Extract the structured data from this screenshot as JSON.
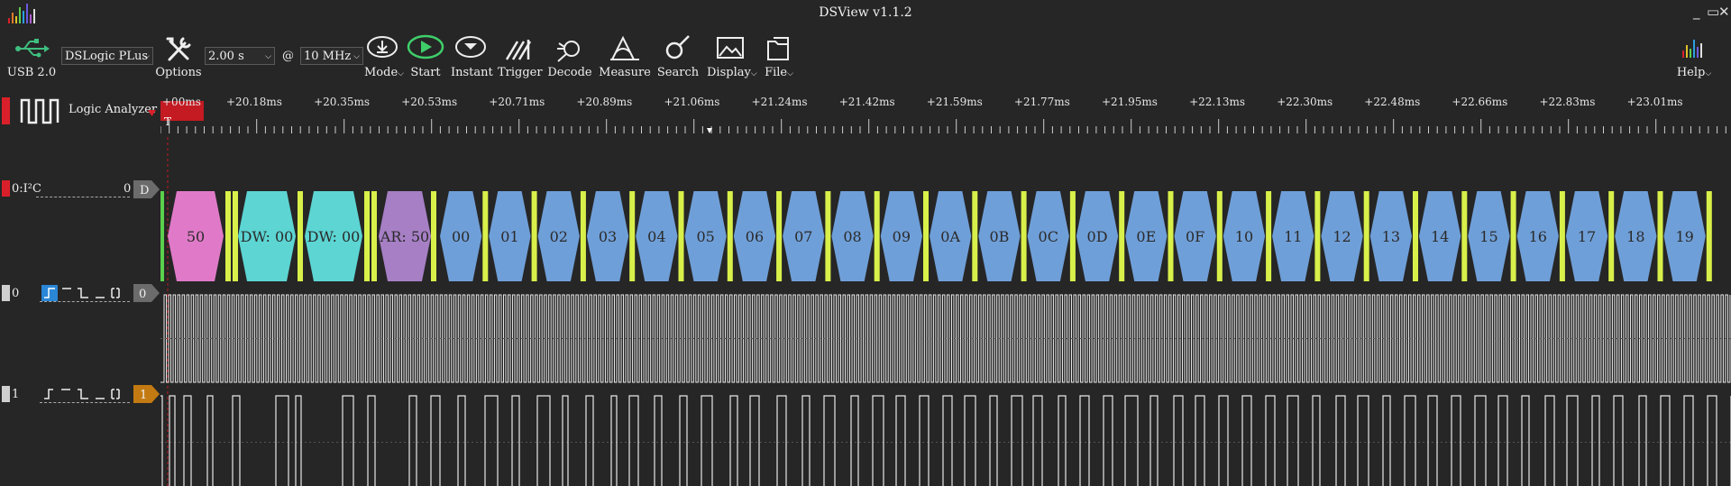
{
  "app": {
    "title": "DSView v1.1.2"
  },
  "toolbar": {
    "usb_label": "USB 2.0",
    "device": "DSLogic PLus",
    "options_label": "Options",
    "duration": "2.00 s",
    "at_symbol": "@",
    "samplerate": "10 MHz",
    "mode_label": "Mode",
    "start_label": "Start",
    "instant_label": "Instant",
    "trigger_label": "Trigger",
    "decode_label": "Decode",
    "measure_label": "Measure",
    "search_label": "Search",
    "display_label": "Display",
    "file_label": "File",
    "help_label": "Help"
  },
  "ruler": {
    "first_label": "+00ms",
    "trigger_marker": "T",
    "ticks": [
      "+20.18ms",
      "+20.35ms",
      "+20.53ms",
      "+20.71ms",
      "+20.89ms",
      "+21.06ms",
      "+21.24ms",
      "+21.42ms",
      "+21.59ms",
      "+21.77ms",
      "+21.95ms",
      "+22.13ms",
      "+22.30ms",
      "+22.48ms",
      "+22.66ms",
      "+22.83ms",
      "+23.01ms"
    ]
  },
  "analyzer": {
    "label": "Logic Analyzer"
  },
  "channels": {
    "decoder": {
      "name": "0:I²C",
      "index": "0",
      "badge": "D"
    },
    "ch0": {
      "num": "0",
      "badge": "0"
    },
    "ch1": {
      "num": "1",
      "badge": "1"
    }
  },
  "decode": {
    "first_block": "50",
    "writes": [
      "DW: 00",
      "DW: 00"
    ],
    "read_addr": "AR: 50",
    "bytes": [
      "00",
      "01",
      "02",
      "03",
      "04",
      "05",
      "06",
      "07",
      "08",
      "09",
      "0A",
      "0B",
      "0C",
      "0D",
      "0E",
      "0F",
      "10",
      "11",
      "12",
      "13",
      "14",
      "15",
      "16",
      "17",
      "18",
      "19"
    ]
  },
  "colors": {
    "address": "#e07ac8",
    "write_data": "#5cd5d3",
    "read_addr": "#a67fc4",
    "data": "#6f9fd8",
    "ack": "#d9f04a",
    "start": "#5ad04c",
    "signal": "#e8e8e8",
    "accent_red": "#d9202a",
    "ch1_badge": "#c47a12"
  }
}
